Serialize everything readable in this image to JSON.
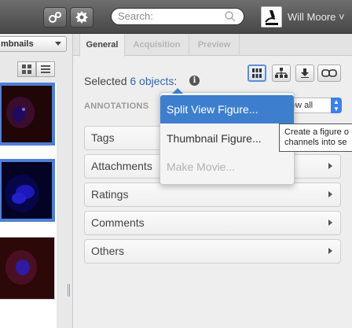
{
  "topbar": {
    "search_placeholder": "Search:",
    "user_name": "Will Moore ˅"
  },
  "left_panel": {
    "view_selector": "mbnails"
  },
  "tabs": [
    {
      "label": "General",
      "active": true
    },
    {
      "label": "Acquisition",
      "active": false
    },
    {
      "label": "Preview",
      "active": false
    }
  ],
  "selection": {
    "prefix": "Selected ",
    "count": "6 objects",
    "suffix": ":"
  },
  "annotations": {
    "label": "ANNOTATIONS",
    "filter_value": "ow all",
    "sections": [
      "Tags",
      "Attachments",
      "Ratings",
      "Comments",
      "Others"
    ]
  },
  "menu": {
    "items": [
      {
        "label": "Split View Figure...",
        "state": "highlighted"
      },
      {
        "label": "Thumbnail Figure...",
        "state": "normal"
      },
      {
        "label": "Make Movie...",
        "state": "disabled"
      }
    ]
  },
  "tooltip": {
    "line1": "Create a figure o",
    "line2": "channels into se"
  },
  "colors": {
    "accent": "#3d7fce",
    "selection_border": "#4f7fd6",
    "link": "#3666b0"
  },
  "icons": [
    "gears-icon",
    "settings-cog-icon",
    "search-icon",
    "microscope-avatar-icon",
    "grid-view-icon",
    "list-view-icon",
    "figure-grid-icon",
    "hierarchy-icon",
    "download-icon",
    "link-icon",
    "info-icon"
  ]
}
